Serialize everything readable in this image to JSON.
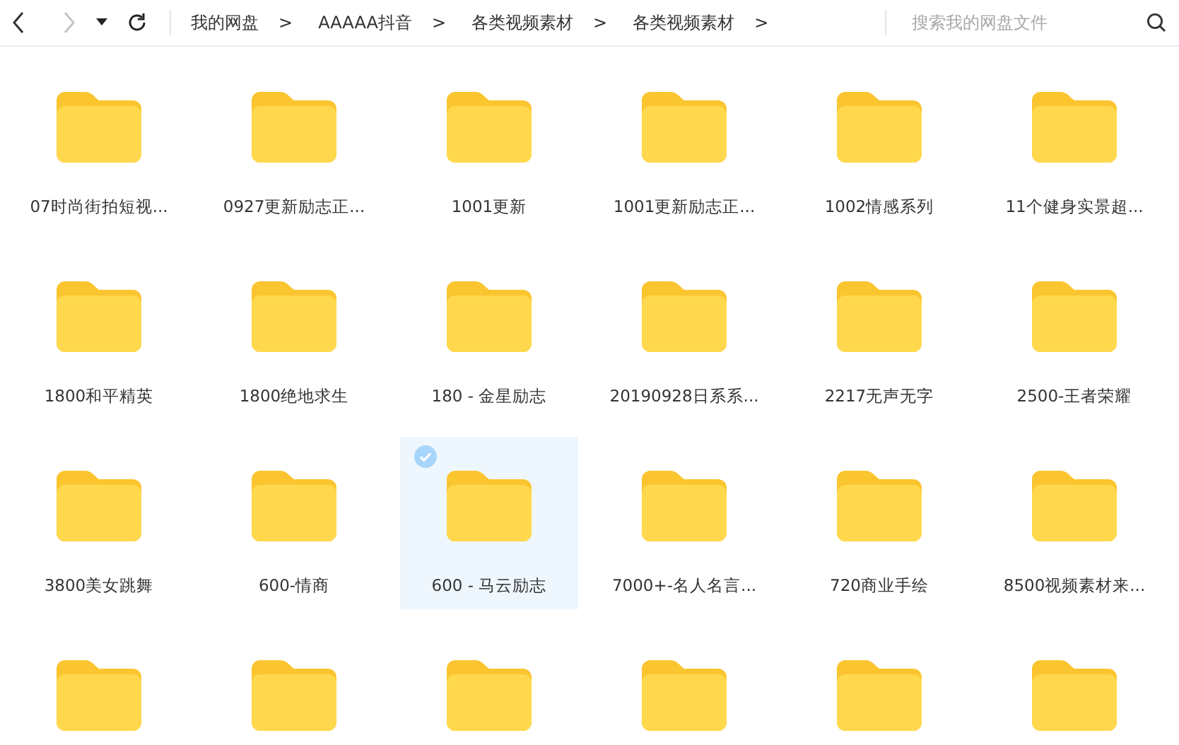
{
  "toolbar": {
    "back_disabled": false,
    "forward_disabled": true
  },
  "breadcrumbs": [
    {
      "label": "我的网盘",
      "separator": ">"
    },
    {
      "label": "AAAAA抖音",
      "separator": ">"
    },
    {
      "label": "各类视频素材",
      "separator": ">"
    },
    {
      "label": "各类视频素材",
      "separator": ">"
    }
  ],
  "search": {
    "placeholder": "搜索我的网盘文件"
  },
  "folders": [
    {
      "name": "07时尚街拍短视...",
      "selected": false
    },
    {
      "name": "0927更新励志正...",
      "selected": false
    },
    {
      "name": "1001更新",
      "selected": false
    },
    {
      "name": "1001更新励志正...",
      "selected": false
    },
    {
      "name": "1002情感系列",
      "selected": false
    },
    {
      "name": "11个健身实景超...",
      "selected": false
    },
    {
      "name": "1800和平精英",
      "selected": false
    },
    {
      "name": "1800绝地求生",
      "selected": false
    },
    {
      "name": "180 - 金星励志",
      "selected": false
    },
    {
      "name": "20190928日系系...",
      "selected": false
    },
    {
      "name": "2217无声无字",
      "selected": false
    },
    {
      "name": "2500-王者荣耀",
      "selected": false
    },
    {
      "name": "3800美女跳舞",
      "selected": false
    },
    {
      "name": "600-情商",
      "selected": false
    },
    {
      "name": "600 - 马云励志",
      "selected": true
    },
    {
      "name": "7000+-名人名言...",
      "selected": false
    },
    {
      "name": "720商业手绘",
      "selected": false
    },
    {
      "name": "8500视频素材来...",
      "selected": false
    },
    {
      "selected": false
    },
    {
      "selected": false
    },
    {
      "selected": false
    },
    {
      "selected": false
    },
    {
      "selected": false
    },
    {
      "selected": false
    }
  ]
}
